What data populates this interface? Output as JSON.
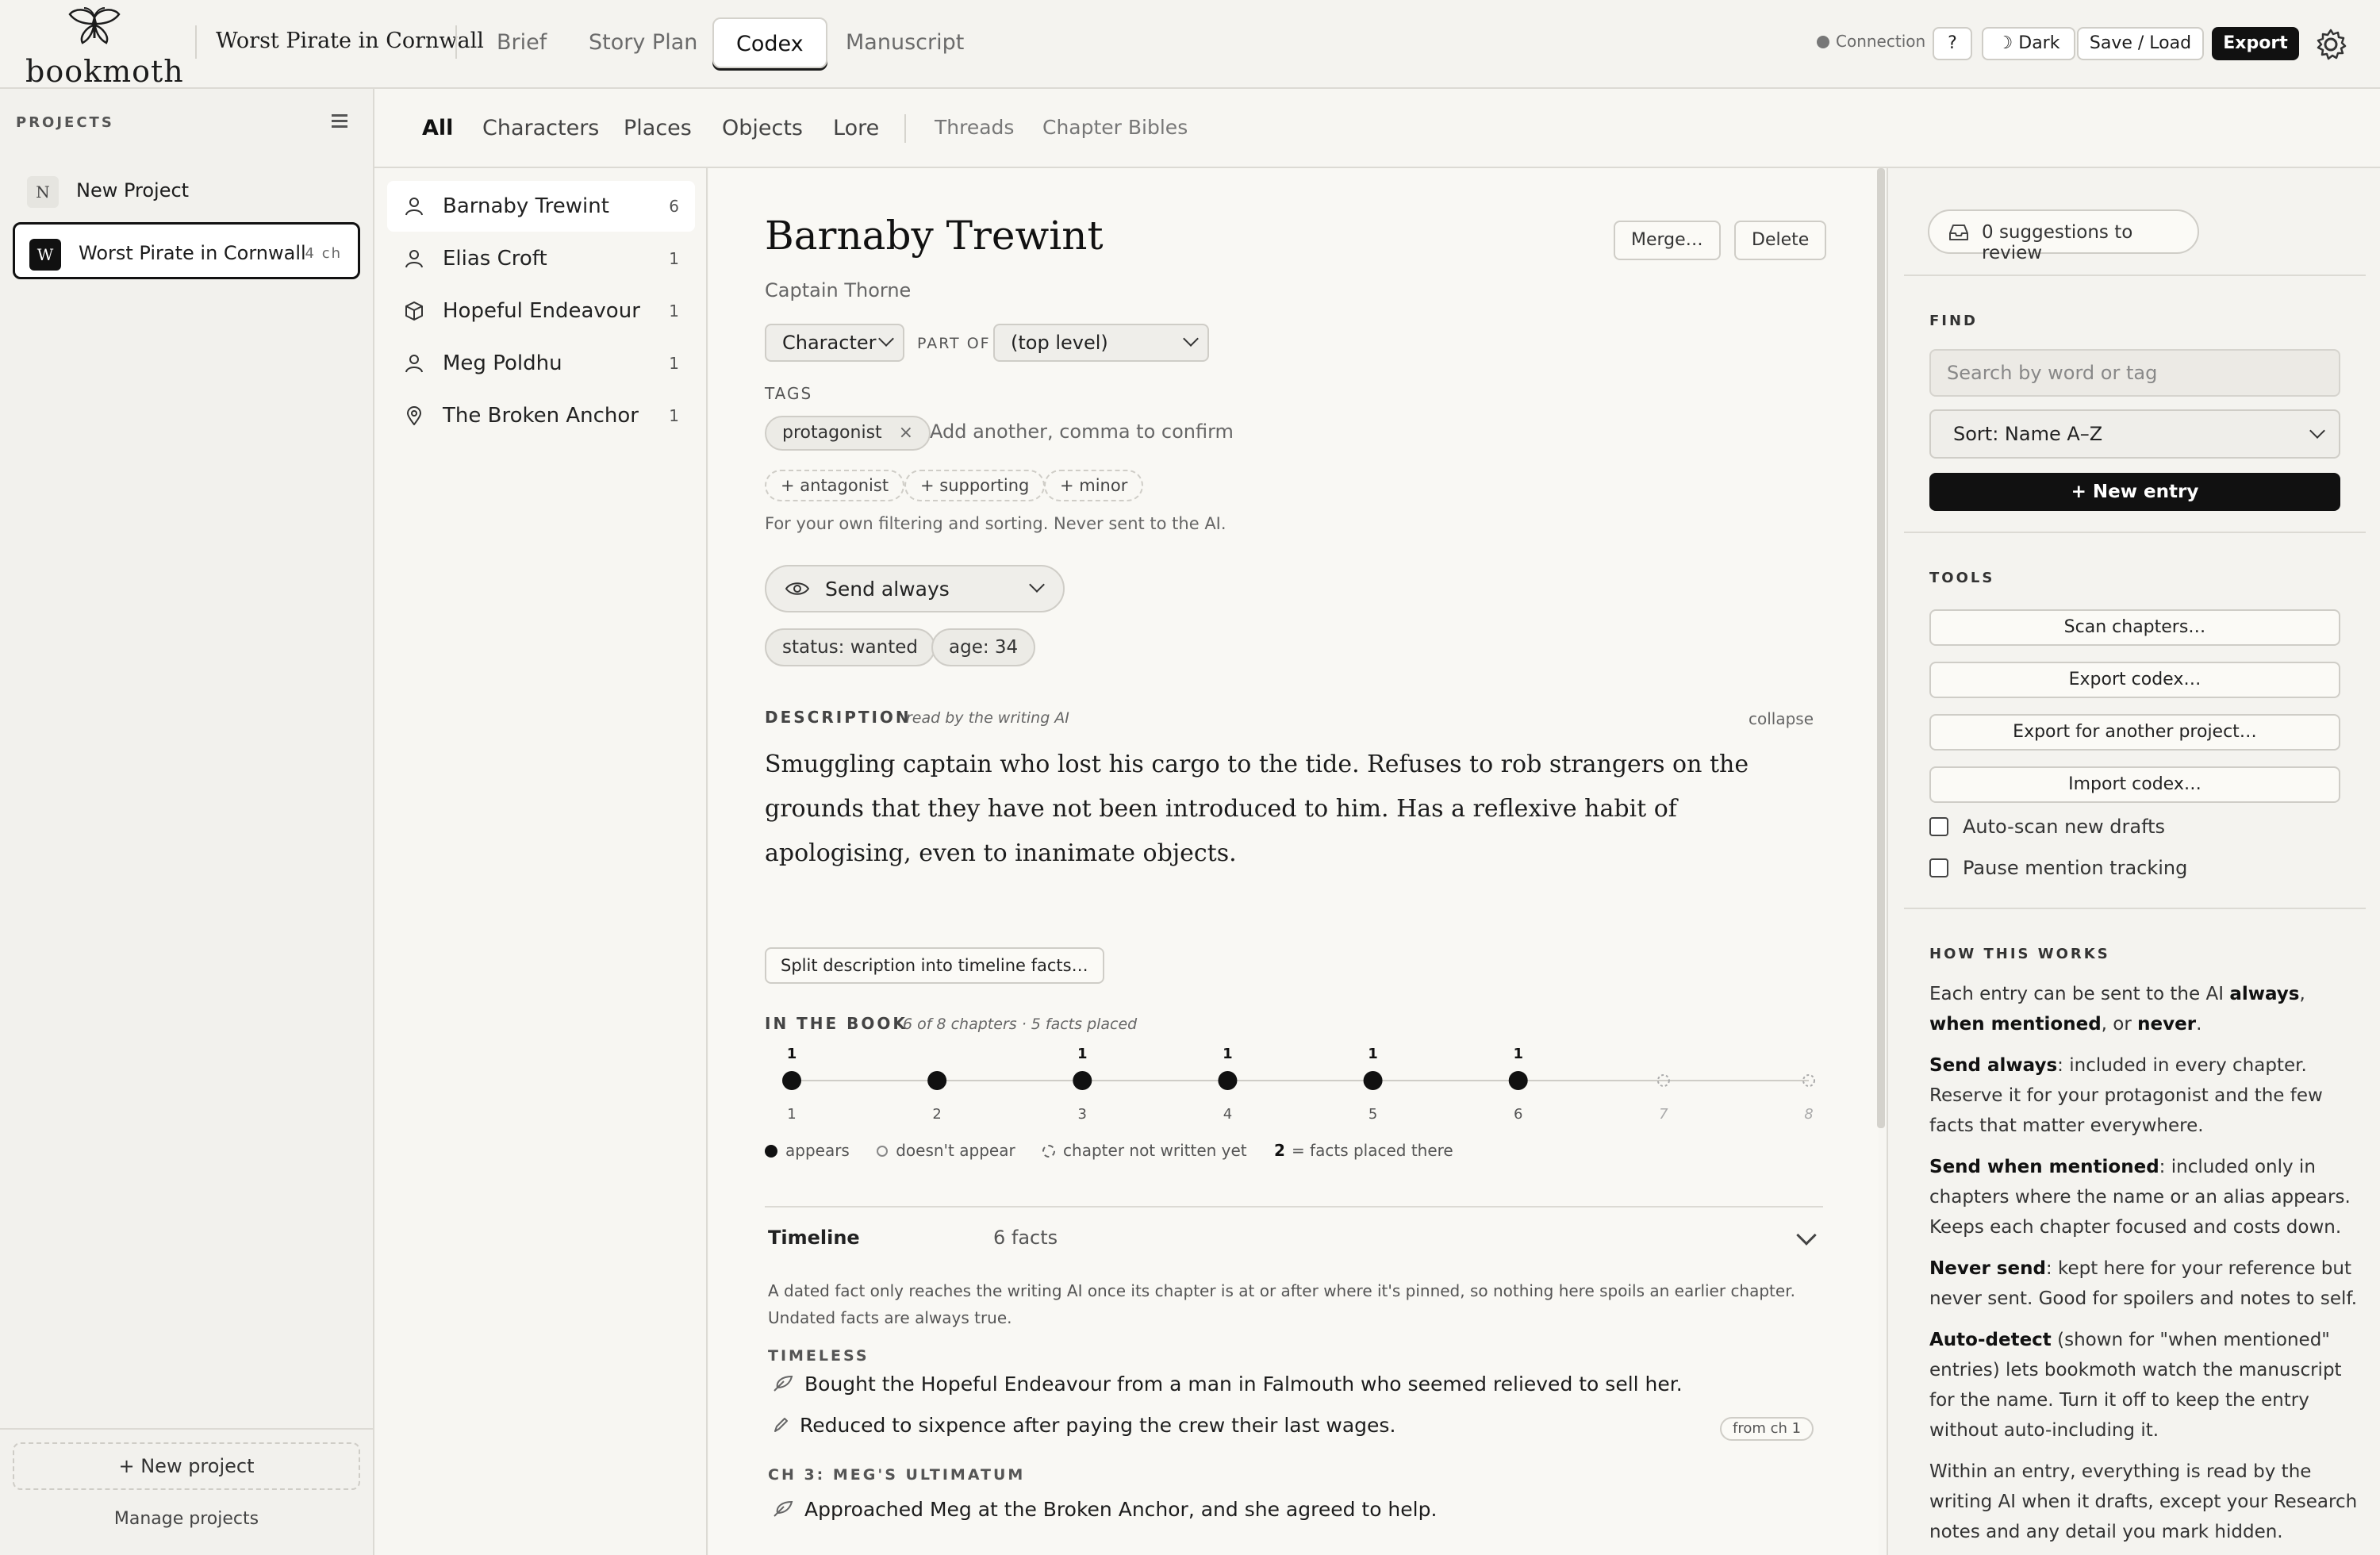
{
  "app": {
    "logo_text": "bookmoth",
    "project_title": "Worst Pirate in Cornwall"
  },
  "nav": {
    "tabs": [
      {
        "label": "Brief"
      },
      {
        "label": "Story Plan"
      },
      {
        "label": "Codex",
        "active": true
      },
      {
        "label": "Manuscript"
      }
    ]
  },
  "toolbar": {
    "connection": "Connection",
    "help": "?",
    "dark": "☽ Dark",
    "save_load": "Save / Load",
    "export": "Export"
  },
  "sidebar": {
    "heading": "PROJECTS",
    "projects": [
      {
        "badge": "N",
        "name": "New Project",
        "chapters": ""
      },
      {
        "badge": "W",
        "name": "Worst Pirate in Cornwall",
        "chapters": "4 ch",
        "active": true
      }
    ],
    "new_project": "+ New project",
    "manage": "Manage projects"
  },
  "categories": {
    "tabs": [
      "All",
      "Characters",
      "Places",
      "Objects",
      "Lore"
    ],
    "extra_tabs": [
      "Threads",
      "Chapter Bibles"
    ]
  },
  "entries": [
    {
      "name": "Barnaby Trewint",
      "count": "6",
      "icon": "person-icon",
      "active": true
    },
    {
      "name": "Elias Croft",
      "count": "1",
      "icon": "person-icon"
    },
    {
      "name": "Hopeful Endeavour",
      "count": "1",
      "icon": "box-icon"
    },
    {
      "name": "Meg Poldhu",
      "count": "1",
      "icon": "person-icon"
    },
    {
      "name": "The Broken Anchor",
      "count": "1",
      "icon": "location-pin-icon"
    }
  ],
  "detail": {
    "name": "Barnaby Trewint",
    "merge": "Merge…",
    "delete": "Delete",
    "alias": "Captain Thorne",
    "type": "Character",
    "part_of_label": "PART OF",
    "part_of": "(top level)",
    "tags_label": "TAGS",
    "tags": [
      "protagonist"
    ],
    "tag_remove": "×",
    "tag_placeholder": "Add another, comma to confirm",
    "suggested_tags": [
      "+ antagonist",
      "+ supporting",
      "+ minor"
    ],
    "tags_hint": "For your own filtering and sorting. Never sent to the AI.",
    "send_mode": "Send always",
    "attributes": [
      "status: wanted",
      "age: 34"
    ],
    "description_label": "DESCRIPTION",
    "description_note": "read by the writing AI",
    "collapse": "collapse",
    "description": "Smuggling captain who lost his cargo to the tide. Refuses to rob strangers on the grounds that they have not been introduced to him. Has a reflexive habit of apologising, even to inanimate objects.",
    "split_button": "Split description into timeline facts…",
    "in_book_label": "IN THE BOOK",
    "in_book_note": "6 of 8 chapters · 5 facts placed",
    "legend": {
      "appears": "appears",
      "not_appear": "doesn't appear",
      "not_written": "chapter not written yet",
      "facts_num": "2",
      "facts_text": "= facts placed there"
    },
    "timeline_title": "Timeline",
    "timeline_count": "6 facts",
    "timeline_note": "A dated fact only reaches the writing AI once its chapter is at or after where it's pinned, so nothing here spoils an earlier chapter. Undated facts are always true.",
    "timeless_label": "TIMELESS",
    "facts_timeless": [
      "Bought the Hopeful Endeavour from a man in Falmouth who seemed relieved to sell her.",
      "Reduced to sixpence after paying the crew their last wages."
    ],
    "from_badge": "from ch 1",
    "ch3_label": "CH 3: MEG'S ULTIMATUM",
    "facts_ch3": [
      "Approached Meg at the Broken Anchor, and she agreed to help."
    ]
  },
  "chart_data": {
    "type": "scatter",
    "categories": [
      "1",
      "2",
      "3",
      "4",
      "5",
      "6",
      "7",
      "8"
    ],
    "appears": [
      true,
      true,
      true,
      true,
      true,
      true,
      null,
      null
    ],
    "written": [
      true,
      true,
      true,
      true,
      true,
      true,
      false,
      false
    ],
    "facts_labels": [
      "1",
      "",
      "1",
      "1",
      "1",
      "1",
      "",
      ""
    ]
  },
  "rpanel": {
    "review": "0 suggestions to review",
    "find_label": "FIND",
    "search_placeholder": "Search by word or tag",
    "sort": "Sort: Name A–Z",
    "new_entry": "+ New entry",
    "tools_label": "TOOLS",
    "tools": [
      "Scan chapters…",
      "Export codex…",
      "Export for another project…",
      "Import codex…"
    ],
    "checks": [
      "Auto-scan new drafts",
      "Pause mention tracking"
    ],
    "how_label": "HOW THIS WORKS",
    "how": {
      "p1_a": "Each entry can be sent to the AI ",
      "p1_b": "always",
      "p1_c": ", ",
      "p1_d": "when mentioned",
      "p1_e": ", or ",
      "p1_f": "never",
      "p1_g": ".",
      "p2_b": "Send always",
      "p2_t": ": included in every chapter. Reserve it for your protagonist and the few facts that matter everywhere.",
      "p3_b": "Send when mentioned",
      "p3_t": ": included only in chapters where the name or an alias appears. Keeps each chapter focused and costs down.",
      "p4_b": "Never send",
      "p4_t": ": kept here for your reference but never sent. Good for spoilers and notes to self.",
      "p5_b": "Auto-detect",
      "p5_t": " (shown for \"when mentioned\" entries) lets bookmoth watch the manuscript for the name. Turn it off to keep the entry without auto-including it.",
      "p6": "Within an entry, everything is read by the writing AI when it drafts, except your Research notes and any detail you mark hidden."
    }
  }
}
